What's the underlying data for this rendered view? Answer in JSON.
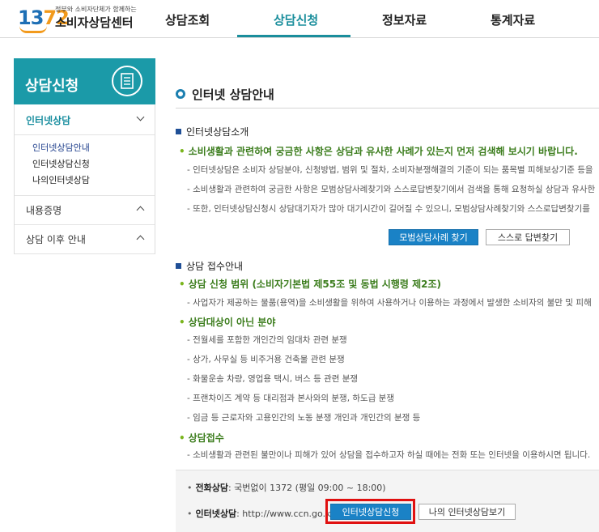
{
  "header": {
    "logo_number_main": "13",
    "logo_number_accent": "72",
    "logo_sub": "정부와 소비자단체가 함께하는",
    "logo_title": "소비자상담센터",
    "nav": [
      "상담조회",
      "상담신청",
      "정보자료",
      "통계자료"
    ],
    "active_nav": "상담신청"
  },
  "sidebar": {
    "title": "상담신청",
    "menu": [
      {
        "label": "인터넷상담",
        "sub": [
          "인터넷상담안내",
          "인터넷상담신청",
          "나의인터넷상담"
        ]
      },
      {
        "label": "내용증명"
      },
      {
        "label": "상담 이후 안내"
      }
    ]
  },
  "content": {
    "page_title": "인터넷 상담안내",
    "section1": {
      "title": "인터넷상담소개",
      "headline": "소비생활과 관련하여 궁금한 사항은 상담과 유사한 사례가 있는지 먼저 검색해 보시기 바랍니다.",
      "lines": [
        "- 인터넷상담은 소비자 상담분야, 신청방법, 범위 및 절차, 소비자분쟁해결의 기준이 되는 품목별 피해보상기준 등을",
        "- 소비생활과 관련하여 궁금한 사항은 모범상담사례찾기와 스스로답변찾기에서 검색을 통해 요청하실 상담과 유사한",
        "- 또한, 인터넷상담신청시 상담대기자가 많아 대기시간이 길어질 수 있으니, 모범상담사례찾기와 스스로답변찾기를"
      ],
      "btn_primary": "모범상담사례 찾기",
      "btn_secondary": "스스로 답변찾기"
    },
    "section2": {
      "title": "상담 접수안내",
      "scope_head": "상담 신청 범위 (소비자기본법 제55조 및 동법 시행령 제2조)",
      "scope_line": "- 사업자가 제공하는 물품(용역)을 소비생활을 위하여 사용하거나 이용하는 과정에서 발생한 소비자의 불만 및 피해",
      "excluded_head": "상담대상이 아닌 분야",
      "excluded_lines": [
        "- 전월세를 포함한 개인간의 임대차 관련 분쟁",
        "- 상가, 사무실 등 비주거용 건축물 관련 분쟁",
        "- 화물운송 차량, 영업용 택시, 버스 등 관련 분쟁",
        "- 프랜차이즈 계약 등 대리점과 본사와의 분쟁, 하도급 분쟁",
        "- 임금 등 근로자와 고용인간의 노동 분쟁 개인과 개인간의 분쟁 등"
      ],
      "reception_head": "상담접수",
      "reception_line": "- 소비생활과 관련된 불만이나 피해가 있어 상담을 접수하고자 하실 때에는 전화 또는 인터넷을 이용하시면 됩니다."
    },
    "info": {
      "phone_label": "전화상담",
      "phone_value": ": 국번없이 1372 (평일 09:00 ~ 18:00)",
      "internet_label": "인터넷상담",
      "internet_value": ": http://www.ccn.go.kr",
      "btn_apply": "인터넷상담신청",
      "btn_view": "나의 인터넷상담보기"
    }
  }
}
